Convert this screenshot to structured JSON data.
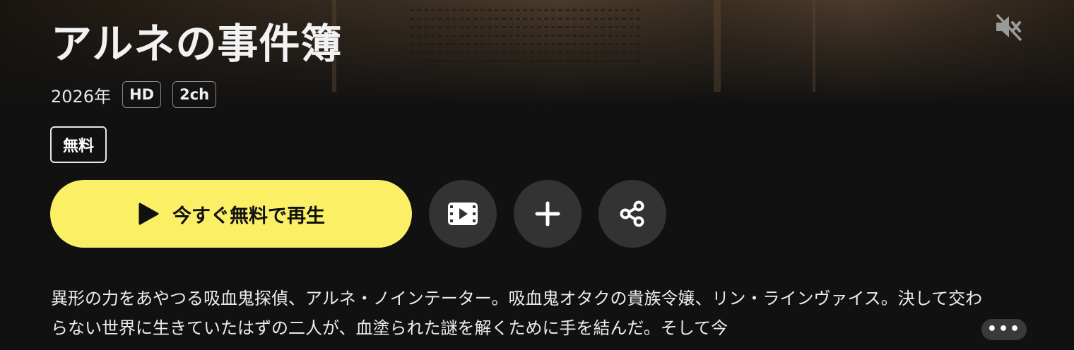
{
  "title": "アルネの事件簿",
  "meta": {
    "year": "2026年",
    "quality_tag": "HD",
    "audio_tag": "2ch"
  },
  "badge": {
    "free": "無料"
  },
  "actions": {
    "play_label": "今すぐ無料で再生",
    "play_icon": "play-icon",
    "trailer_icon": "film-icon",
    "mylist_icon": "plus-icon",
    "share_icon": "share-icon",
    "mute_icon": "speaker-muted-icon"
  },
  "synopsis": {
    "text": "異形の力をあやつる吸血鬼探偵、アルネ・ノインテーター。吸血鬼オタクの貴族令嬢、リン・ラインヴァイス。決して交わらない世界に生きていたはずの二人が、血塗られた謎を解くために手を結んだ。そして今",
    "more_label": "•••"
  },
  "colors": {
    "accent_yellow": "#fbf065",
    "background": "#111111",
    "round_button": "#333333"
  }
}
